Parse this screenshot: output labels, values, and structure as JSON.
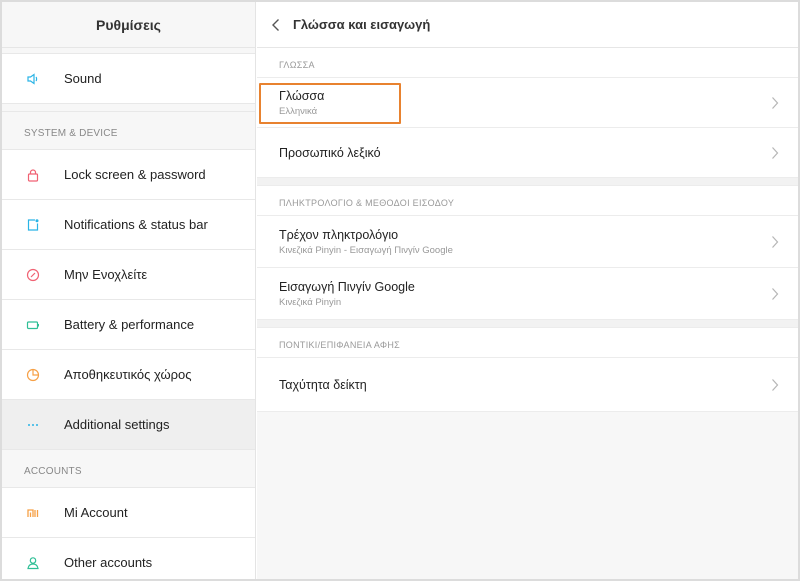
{
  "sidebar": {
    "title": "Ρυθμίσεις",
    "top_items": [
      {
        "label": "Sound",
        "icon": "speaker-icon",
        "color": "#2ab4e6"
      }
    ],
    "section_system": "SYSTEM & DEVICE",
    "system_items": [
      {
        "label": "Lock screen & password",
        "icon": "lock-icon",
        "color": "#f06273"
      },
      {
        "label": "Notifications & status bar",
        "icon": "notification-icon",
        "color": "#2ab4e6"
      },
      {
        "label": "Μην Ενοχλείτε",
        "icon": "do-not-disturb-icon",
        "color": "#f06273"
      },
      {
        "label": "Battery & performance",
        "icon": "battery-icon",
        "color": "#2fbf96"
      },
      {
        "label": "Αποθηκευτικός χώρος",
        "icon": "storage-icon",
        "color": "#f6a046"
      },
      {
        "label": "Additional settings",
        "icon": "more-icon",
        "color": "#2ab4e6",
        "active": true
      }
    ],
    "section_accounts": "ACCOUNTS",
    "account_items": [
      {
        "label": "Mi Account",
        "icon": "mi-icon",
        "color": "#f6a046"
      },
      {
        "label": "Other accounts",
        "icon": "user-icon",
        "color": "#2fbf96"
      }
    ]
  },
  "main": {
    "title": "Γλώσσα και εισαγωγή",
    "sections": [
      {
        "header": "ΓΛΩΣΣΑ",
        "items": [
          {
            "label": "Γλώσσα",
            "sub": "Ελληνικά"
          },
          {
            "label": "Προσωπικό λεξικό",
            "sub": ""
          }
        ]
      },
      {
        "header": "ΠΛΗΚΤΡΟΛΟΓΙΟ & ΜΕΘΟΔΟΙ ΕΙΣΟΔΟΥ",
        "items": [
          {
            "label": "Τρέχον πληκτρολόγιο",
            "sub": "Κινεζικά Pinyin - Εισαγωγή Πινγίν Google"
          },
          {
            "label": "Εισαγωγή Πινγίν Google",
            "sub": "Κινεζικά Pinyin"
          }
        ]
      },
      {
        "header": "ΠΟΝΤΙΚΙ/ΕΠΙΦΑΝΕΙΑ ΑΦΗΣ",
        "items": [
          {
            "label": "Ταχύτητα δείκτη",
            "sub": ""
          }
        ]
      }
    ],
    "highlight_color": "#e8822f"
  }
}
